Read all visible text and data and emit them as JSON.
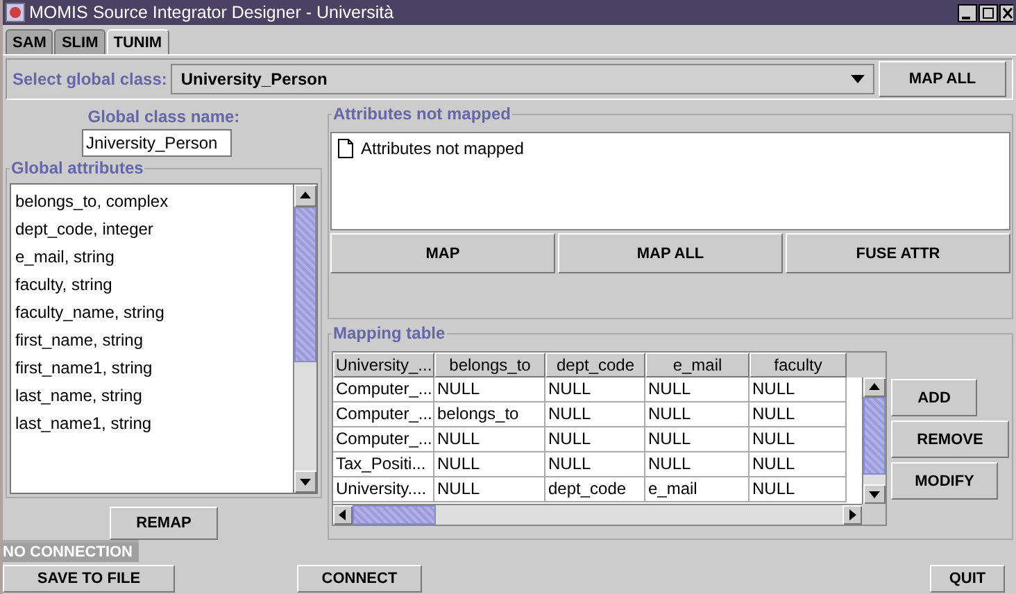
{
  "window": {
    "title": "MOMIS Source Integrator Designer - Università"
  },
  "tabs": [
    {
      "label": "SAM",
      "selected": false
    },
    {
      "label": "SLIM",
      "selected": false
    },
    {
      "label": "TUNIM",
      "selected": true
    }
  ],
  "global_class_select": {
    "label": "Select global class:",
    "value": "University_Person",
    "button": "MAP ALL"
  },
  "global_class_name": {
    "label": "Global class name:",
    "value": "Jniversity_Person"
  },
  "global_attributes": {
    "title": "Global attributes",
    "items": [
      "belongs_to, complex",
      "dept_code, integer",
      "e_mail, string",
      "faculty, string",
      "faculty_name, string",
      "first_name, string",
      "first_name1, string",
      "last_name, string",
      "last_name1, string"
    ],
    "button": "REMAP"
  },
  "attributes_not_mapped": {
    "title": "Attributes not mapped",
    "items": [
      "Attributes not mapped"
    ],
    "buttons": [
      "MAP",
      "MAP ALL",
      "FUSE ATTR"
    ]
  },
  "mapping_table": {
    "title": "Mapping table",
    "columns": [
      "University_...",
      "belongs_to",
      "dept_code",
      "e_mail",
      "faculty"
    ],
    "rows": [
      [
        "Computer_...",
        "NULL",
        "NULL",
        "NULL",
        "NULL"
      ],
      [
        "Computer_...",
        "belongs_to",
        "NULL",
        "NULL",
        "NULL"
      ],
      [
        "Computer_...",
        "NULL",
        "NULL",
        "NULL",
        "NULL"
      ],
      [
        "Tax_Positi...",
        "NULL",
        "NULL",
        "NULL",
        "NULL"
      ],
      [
        "University....",
        "NULL",
        "dept_code",
        "e_mail",
        "NULL"
      ]
    ],
    "buttons": [
      "ADD",
      "REMOVE",
      "MODIFY"
    ]
  },
  "status": "NO CONNECTION",
  "bottom_buttons": [
    "SAVE TO FILE",
    "CONNECT",
    "QUIT"
  ]
}
